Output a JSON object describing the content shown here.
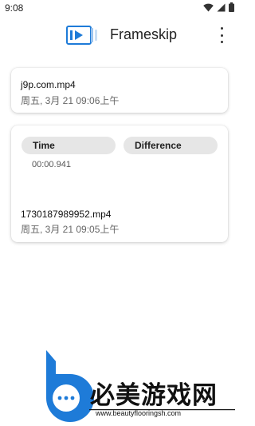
{
  "status_bar": {
    "time": "9:08"
  },
  "app_bar": {
    "title": "Frameskip",
    "logo_icon": "frameskip-logo-icon",
    "menu_icon": "more-vert-icon"
  },
  "files": [
    {
      "name": "j9p.com.mp4",
      "date": "周五, 3月 21 09:06上午"
    }
  ],
  "comparison": {
    "col_time": "Time",
    "col_difference": "Difference",
    "time_value": "00:00.941",
    "file_name": "1730187989952.mp4",
    "file_date": "周五, 3月 21 09:05上午"
  },
  "watermark": {
    "text": "必美游戏网",
    "url": "www.beautyflooringsh.com"
  },
  "colors": {
    "accent": "#1e7bd8",
    "card_bg": "#ffffff",
    "pill_bg": "#e6e6e6"
  }
}
